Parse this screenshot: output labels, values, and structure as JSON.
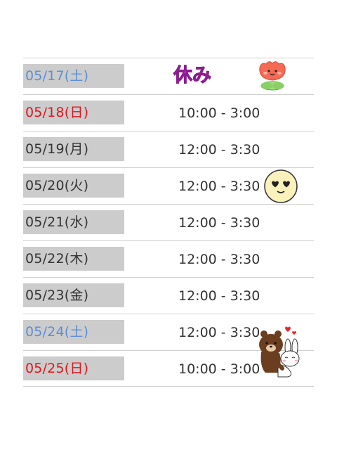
{
  "colors": {
    "weekday": "#333333",
    "saturday": "#5b8fd6",
    "sunday": "#e0151c"
  },
  "rows": [
    {
      "date": "05/17(土)",
      "day_type": "saturday",
      "time": "",
      "note": "休み"
    },
    {
      "date": "05/18(日)",
      "day_type": "sunday",
      "time": "10:00 - 3:00"
    },
    {
      "date": "05/19(月)",
      "day_type": "weekday",
      "time": "12:00 - 3:30"
    },
    {
      "date": "05/20(火)",
      "day_type": "weekday",
      "time": "12:00 - 3:30"
    },
    {
      "date": "05/21(水)",
      "day_type": "weekday",
      "time": "12:00 - 3:30"
    },
    {
      "date": "05/22(木)",
      "day_type": "weekday",
      "time": "12:00 - 3:30"
    },
    {
      "date": "05/23(金)",
      "day_type": "weekday",
      "time": "12:00 - 3:30"
    },
    {
      "date": "05/24(土)",
      "day_type": "saturday",
      "time": "12:00 - 3:30"
    },
    {
      "date": "05/25(日)",
      "day_type": "sunday",
      "time": "10:00 - 3:00"
    }
  ],
  "stickers": [
    "tulip-sticker",
    "heart-eyes-smiley-sticker",
    "bear-and-bunny-sticker"
  ]
}
